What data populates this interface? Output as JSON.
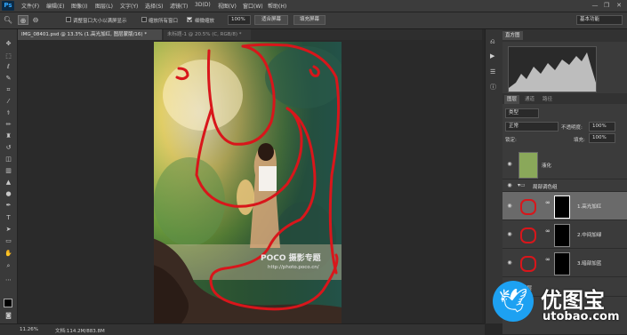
{
  "app": {
    "logo": "Ps"
  },
  "menu": [
    "文件(F)",
    "编辑(E)",
    "图像(I)",
    "图层(L)",
    "文字(Y)",
    "选择(S)",
    "滤镜(T)",
    "3D(D)",
    "视图(V)",
    "窗口(W)",
    "帮助(H)"
  ],
  "window_controls": {
    "minimize": "—",
    "restore": "❐",
    "close": "✕"
  },
  "options": {
    "resize_windows_label": "调整窗口大小以满屏显示",
    "zoom_all_label": "缩放所有窗口",
    "scrubby_zoom_label": "细微缩放",
    "scrubby_zoom_checked": true,
    "zoom_value": "100%",
    "fit_screen_label": "适合屏幕",
    "fill_screen_label": "填充屏幕",
    "workspace": "基本功能"
  },
  "tabs": [
    {
      "label": "IMG_08401.psd @ 13.3% (1.高光加红, 图层蒙版/16) *",
      "active": true
    },
    {
      "label": "未标题-1 @ 20.5% (C, RGB/8) *",
      "active": false
    }
  ],
  "status": {
    "zoom": "11.26%",
    "doc": "文档:114.2M/883.8M"
  },
  "panels": {
    "histogram_tab": "直方图",
    "layers_tabs": [
      "图层",
      "通道",
      "路径"
    ],
    "filter_kind": "类型",
    "blend_mode": "正常",
    "opacity_label": "不透明度:",
    "opacity_value": "100%",
    "lock_label": "锁定:",
    "fill_label": "填充:",
    "fill_value": "100%"
  },
  "layers": [
    {
      "name": "液化",
      "type": "pixel"
    },
    {
      "name": "局部调色组",
      "type": "group"
    },
    {
      "name": "1.高光加红",
      "type": "adjustment",
      "selected": true
    },
    {
      "name": "2.中间加绿",
      "type": "adjustment"
    },
    {
      "name": "3.暗部加蓝",
      "type": "adjustment"
    },
    {
      "name": "图层",
      "type": "pixel"
    }
  ],
  "watermark": {
    "brand": "POCO 摄影专题",
    "url": "http://photo.poco.cn/"
  },
  "corner_logo": {
    "title": "优图宝",
    "url": "utobao.com"
  },
  "colors": {
    "annotation_red": "#d8161b",
    "accent": "#31a8ff",
    "twitter_blue": "#1da1f2"
  },
  "icons": [
    "move-icon",
    "marquee-icon",
    "lasso-icon",
    "quick-select-icon",
    "crop-icon",
    "eyedropper-icon",
    "healing-icon",
    "brush-icon",
    "stamp-icon",
    "history-brush-icon",
    "eraser-icon",
    "gradient-icon",
    "blur-icon",
    "dodge-icon",
    "pen-icon",
    "type-icon",
    "path-select-icon",
    "shape-icon",
    "hand-icon",
    "zoom-icon"
  ]
}
